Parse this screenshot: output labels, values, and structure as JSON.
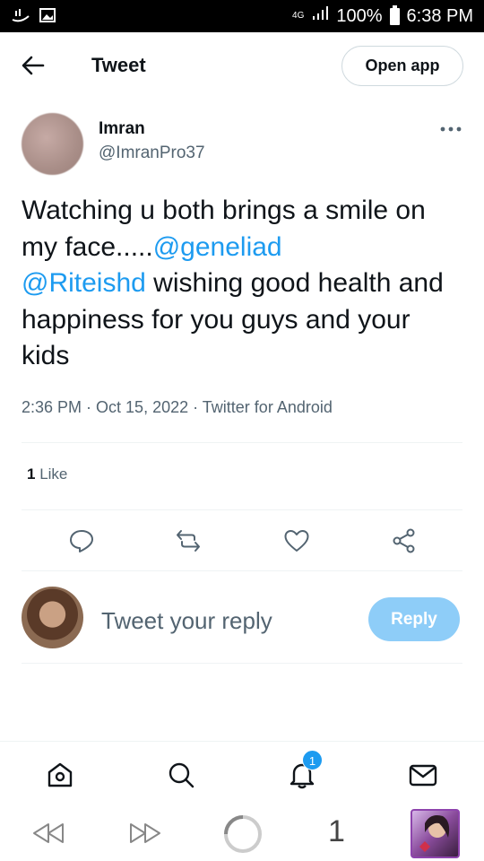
{
  "status_bar": {
    "network": "4G",
    "battery": "100%",
    "time": "6:38 PM"
  },
  "header": {
    "title": "Tweet",
    "open_app_label": "Open app"
  },
  "tweet": {
    "author_name": "Imran",
    "author_handle": "@ImranPro37",
    "text_part1": "Watching u both brings a smile on my face.....",
    "mention1": "@geneliad",
    "mention2": "@Riteishd",
    "text_part2": " wishing good health and happiness for you guys and your kids",
    "time": "2:36 PM",
    "date": "Oct 15, 2022",
    "source": "Twitter for Android",
    "like_count": "1",
    "like_label": "Like"
  },
  "reply": {
    "placeholder": "Tweet your reply",
    "button_label": "Reply"
  },
  "bottom_nav": {
    "notification_badge": "1"
  },
  "browser": {
    "tab_count": "1"
  },
  "colors": {
    "accent": "#1d9bf0",
    "reply_button_disabled": "#8ecdf8",
    "secondary_text": "#536471"
  }
}
